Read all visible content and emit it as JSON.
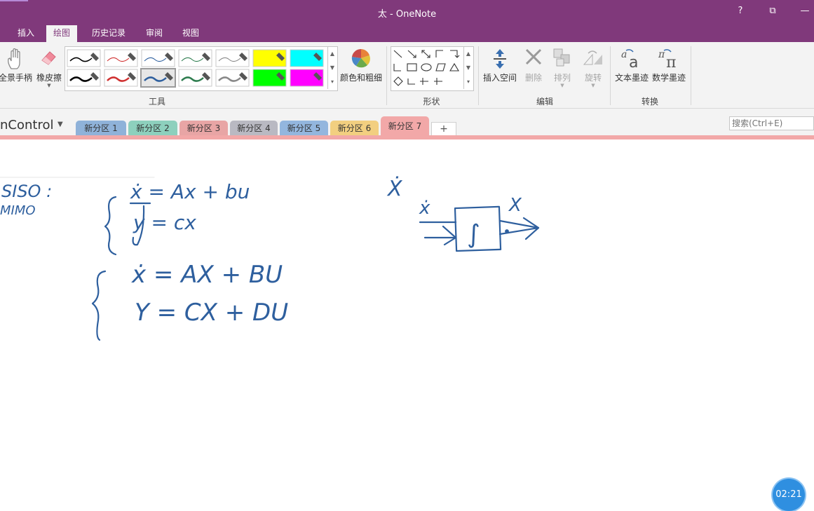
{
  "window": {
    "title": "太 - OneNote",
    "help": "?",
    "restore": "⧉",
    "minimize": "—"
  },
  "menu": {
    "tabs": [
      {
        "label": "插入"
      },
      {
        "label": "绘图"
      },
      {
        "label": "历史记录"
      },
      {
        "label": "审阅"
      },
      {
        "label": "视图"
      }
    ],
    "active": "绘图"
  },
  "ribbon": {
    "pan": "全景手柄",
    "eraser": "橡皮擦",
    "color_weight": "颜色和粗细",
    "insert_space": "插入空间",
    "delete": "删除",
    "arrange": "排列",
    "rotate": "旋转",
    "ink_to_text": "文本墨迹",
    "ink_to_math": "数学墨迹",
    "groups": {
      "tools": "工具",
      "shapes": "形状",
      "edit": "编辑",
      "convert": "转换"
    }
  },
  "notebook": {
    "name": "nControl",
    "sections": [
      {
        "label": "新分区 1",
        "color": "#8fb2d9"
      },
      {
        "label": "新分区 2",
        "color": "#8dd0bd"
      },
      {
        "label": "新分区 3",
        "color": "#e8a5a5"
      },
      {
        "label": "新分区 4",
        "color": "#b9b9c2"
      },
      {
        "label": "新分区 5",
        "color": "#93b6de"
      },
      {
        "label": "新分区 6",
        "color": "#f2cf80"
      },
      {
        "label": "新分区 7",
        "color": "#f2a8a8"
      }
    ],
    "add_tab": "+",
    "active_section": "新分区 7"
  },
  "search": {
    "placeholder": "搜索(Ctrl+E)"
  },
  "ink": {
    "left_note_1": "SISO :",
    "left_note_2": "MIMO",
    "siso_eq1": "ẋ = Ax + bu",
    "siso_eq2": "y = cx",
    "mimo_eq1": "ẋ = AX + BU",
    "mimo_eq2": "Y = CX + DU",
    "diagram_in": "ẋ",
    "diagram_out": "X",
    "diagram_block": "∫",
    "diagram_top": "Ẋ"
  },
  "timer": "02:21",
  "colors": {
    "titlebar": "#80397b",
    "ink": "#2e5f9e",
    "active_section": "#f2a8a8"
  }
}
